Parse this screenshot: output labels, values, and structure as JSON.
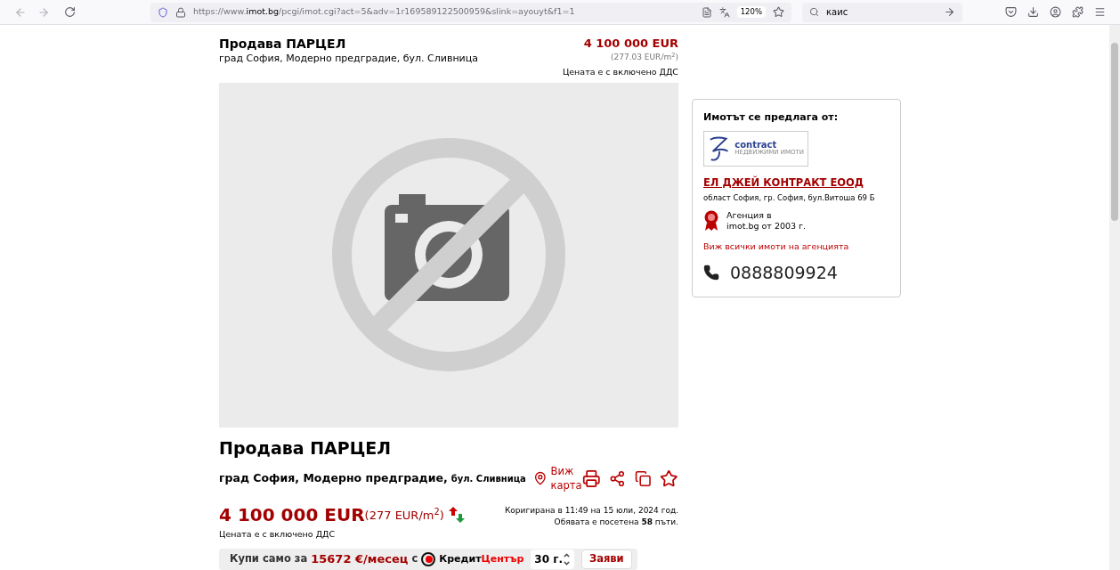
{
  "browser": {
    "url_prefix": "https://www.",
    "url_domain": "imot.bg",
    "url_path": "/pcgi/imot.cgi?act=5&adv=1r169589122500959&slink=ayouyt&f1=1",
    "zoom": "120%",
    "search_value": "каис"
  },
  "header": {
    "title": "Продава ПАРЦЕЛ",
    "location": "град София, Модерно предградие, бул. Сливница",
    "price": "4 100 000 EUR",
    "price_per_m2": "(277.03 EUR/m$^{2}$)",
    "vat_note": "Цената е с включено ДДС"
  },
  "photo": {
    "kind": "no-photo"
  },
  "details": {
    "title": "Продава ПАРЦЕЛ",
    "location": "град София, Модерно предградие,",
    "street": "бул. Сливница",
    "map_link": "Виж карта",
    "price": "4 100 000 EUR",
    "price_per_m2": "(277 EUR/m$^{2}$)",
    "vat_note": "Цената е с включено ДДС",
    "modified": "Коригирана в 11:49 на 15 юли, 2024 год.",
    "views": "Обявата е посетена **58** пъти."
  },
  "credit": {
    "prefix": "Купи само за",
    "amount": "15672 €/месец",
    "suffix": "с",
    "brand_1": "Кредит",
    "brand_2": "Център",
    "years": "30 г.",
    "apply": "Заяви"
  },
  "agency": {
    "heading": "Имотът се предлага от:",
    "logo_text": "contract",
    "logo_sub": "НЕДВИЖИМИ ИМОТИ",
    "name": "ЕЛ ДЖЕЙ КОНТРАКТ ЕООД",
    "address": "област София, гр. София, бул.Витоша 69 Б",
    "badge_line_1": "Агенция в",
    "badge_line_2": "imot.bg от 2003 г.",
    "all_link": "Виж всички имоти на агенцията",
    "phone": "0888809924"
  }
}
